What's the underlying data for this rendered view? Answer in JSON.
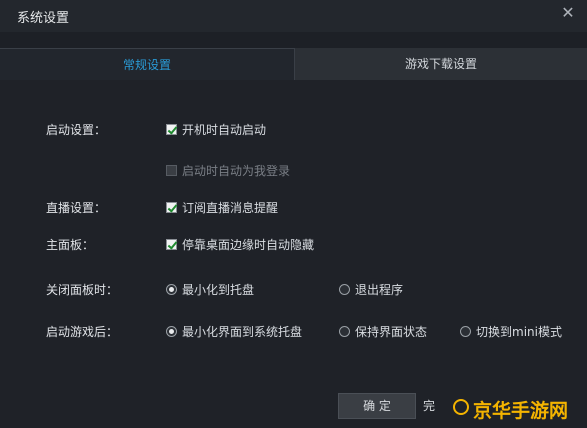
{
  "window": {
    "title": "系统设置",
    "close_glyph": "✕"
  },
  "tabs": [
    {
      "label": "常规设置",
      "active": true
    },
    {
      "label": "游戏下载设置",
      "active": false
    }
  ],
  "settings": {
    "startup": {
      "label": "启动设置：",
      "options": [
        {
          "label": "开机时自动启动",
          "checked": true,
          "enabled": true
        },
        {
          "label": "启动时自动为我登录",
          "checked": false,
          "enabled": false
        }
      ]
    },
    "live": {
      "label": "直播设置：",
      "options": [
        {
          "label": "订阅直播消息提醒",
          "checked": true,
          "enabled": true
        }
      ]
    },
    "main_panel": {
      "label": "主面板：",
      "options": [
        {
          "label": "停靠桌面边缘时自动隐藏",
          "checked": true,
          "enabled": true
        }
      ]
    },
    "close_panel": {
      "label": "关闭面板时：",
      "options": [
        {
          "label": "最小化到托盘",
          "selected": true
        },
        {
          "label": "退出程序",
          "selected": false
        }
      ]
    },
    "game_start": {
      "label": "启动游戏后：",
      "options": [
        {
          "label": "最小化界面到系统托盘",
          "selected": true
        },
        {
          "label": "保持界面状态",
          "selected": false
        },
        {
          "label": "切换到mini模式",
          "selected": false
        }
      ]
    }
  },
  "buttons": {
    "ok": "确 定",
    "cancel": "完"
  },
  "watermark": {
    "text": "京华手游网"
  },
  "colors": {
    "accent": "#2a9bd6",
    "check": "#1f8a2f",
    "watermark": "#f4b400"
  }
}
